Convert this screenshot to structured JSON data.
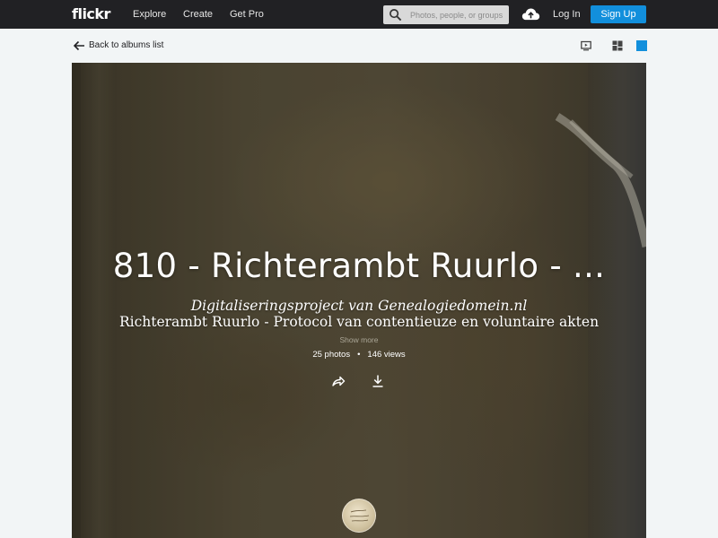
{
  "topbar": {
    "logo": "flickr",
    "nav": {
      "explore": "Explore",
      "create": "Create",
      "get_pro": "Get Pro"
    },
    "search": {
      "placeholder": "Photos, people, or groups"
    },
    "icons": {
      "search": "search-icon",
      "upload": "cloud-upload-icon"
    },
    "login": "Log In",
    "signup": "Sign Up",
    "colors": {
      "background": "#212124",
      "signup": "#128fdc"
    }
  },
  "subheader": {
    "back_label": "Back to albums list",
    "icons": {
      "back": "arrow-left-icon",
      "views": [
        "slideshow-icon",
        "grid-view-icon",
        "single-view-icon"
      ]
    },
    "active_view_color": "#128fdc"
  },
  "album": {
    "title": "810 - Richterambt Ruurlo - ...",
    "description_line1": "Digitaliseringsproject van Genealogiedomein.nl",
    "description_line2": "Richterambt Ruurlo - Protocol van contentieuze en voluntaire akten",
    "show_more": "Show more",
    "photos": "25 photos",
    "separator": "•",
    "views": "146 views",
    "icons": {
      "share": "share-arrow-icon",
      "download": "download-icon",
      "owner": "avatar"
    }
  }
}
